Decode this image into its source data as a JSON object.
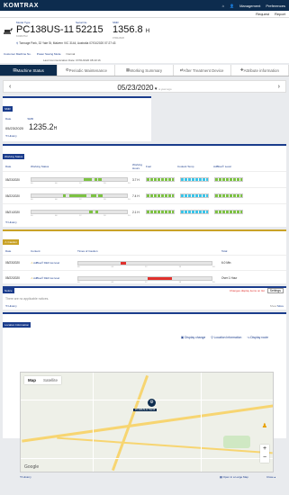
{
  "app": {
    "brand": "KOMTRAX",
    "management": "Management",
    "preferences": "Preferences",
    "request": "Request",
    "report": "Report"
  },
  "machine": {
    "model_label": "Model Type",
    "model": "PC138US-11",
    "model_sub": "KOMATSU",
    "serial_label": "Serial No.",
    "serial": "52215",
    "smr_label": "SMR",
    "smr": "1356.8",
    "smr_unit": "H",
    "smr_date": "07/01/2020",
    "address": "Tonnage Park, 32 Yale St, Malvern VIC 3144, Australia 07/01/2020 07:27:43"
  },
  "status_bar": {
    "customer_link": "Customer Machine No.",
    "power_link": "Power Saving Mode",
    "power_value": "Normal",
    "last_comm": "Last Communication Date: 07/01/2020 08:43:16"
  },
  "tabs": [
    "Machine Status",
    "Periodic Maintenance",
    "Working Summary",
    "After Treatment Device",
    "Attribute information"
  ],
  "date": {
    "value": "05/23/2020",
    "ago": "a year ago"
  },
  "smr_card": {
    "header": "SMR",
    "date_label": "Date",
    "smr_label": "SMR",
    "date": "05/23/2020",
    "value": "1235.2",
    "unit": "H",
    "history": "History"
  },
  "working": {
    "header": "Working Status",
    "cols": {
      "date": "Date",
      "status": "Working Status",
      "hours": "Working Hours",
      "fuel": "Fuel",
      "coolant": "Coolant Temp",
      "adblue": "AdBlue® Level"
    },
    "rows": [
      {
        "date": "05/23/2020",
        "hours": "3.7 H",
        "segs": [
          [
            0.55,
            0.08
          ],
          [
            0.66,
            0.03
          ],
          [
            0.7,
            0.04
          ]
        ]
      },
      {
        "date": "05/22/2020",
        "hours": "7.4 H",
        "segs": [
          [
            0.33,
            0.03
          ],
          [
            0.4,
            0.18
          ],
          [
            0.62,
            0.06
          ],
          [
            0.7,
            0.05
          ]
        ]
      },
      {
        "date": "05/21/2020",
        "hours": "2.1 H",
        "segs": [
          [
            0.6,
            0.04
          ],
          [
            0.67,
            0.03
          ]
        ]
      }
    ],
    "scale": [
      "00",
      "06",
      "12",
      "18",
      "24"
    ],
    "history": "History"
  },
  "caution": {
    "header": "Caution",
    "cols": {
      "date": "Date",
      "content": "Content",
      "times": "Times of Caution",
      "total": "Total"
    },
    "rows": [
      {
        "date": "05/23/2020",
        "content": "AdBlue® DEF low level",
        "seg": [
          0.32,
          0.04
        ],
        "total": "6.0 Min"
      },
      {
        "date": "05/22/2020",
        "content": "AdBlue® DEF low level",
        "seg": [
          0.52,
          0.18
        ],
        "total": "Over 1 Hour"
      }
    ],
    "history": "History",
    "show": "Show",
    "more": "More"
  },
  "notice": {
    "header": "Notice",
    "changes": "Changes display items on list",
    "settings": "Settings",
    "empty": "There are no applicable notices.",
    "history": "History",
    "show": "Show",
    "more": "More"
  },
  "location": {
    "header": "Location Information",
    "display_change": "Display change",
    "location_info": "Location Information",
    "display_route": "Display route",
    "map": "Map",
    "satellite": "Satellite",
    "marker": "PC138US-11 52215",
    "history": "History",
    "open_map": "Open in a Large Map",
    "close": "Close"
  },
  "colors": {
    "navy": "#0d2c4e",
    "accent": "#1a3c8c",
    "green": "#7cc242",
    "cyan": "#3ac4e8",
    "red": "#e0312d",
    "yellow": "#c9a227"
  }
}
